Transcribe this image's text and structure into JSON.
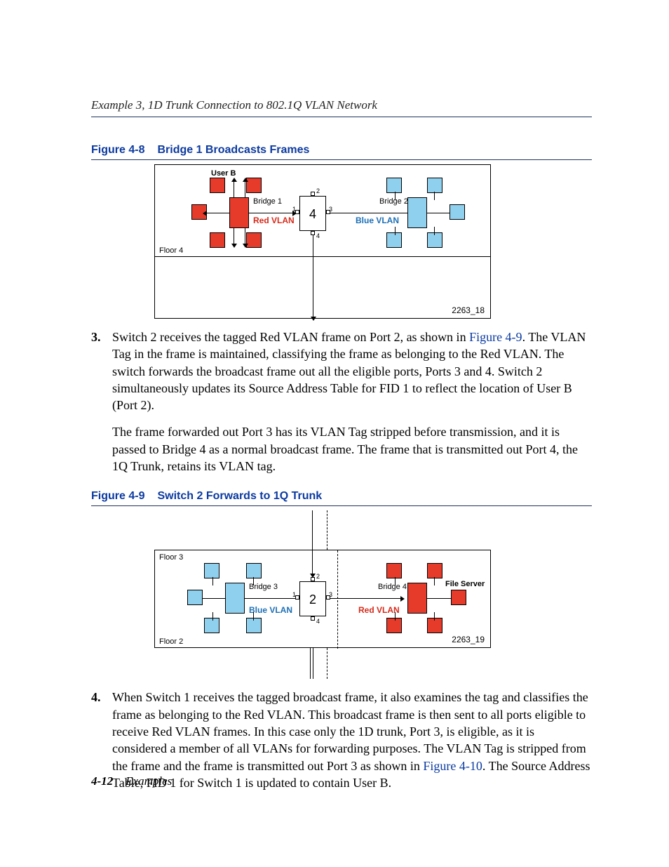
{
  "header": {
    "running": "Example 3, 1D Trunk Connection to 802.1Q VLAN Network"
  },
  "fig1": {
    "num": "Figure 4-8",
    "title": "Bridge 1 Broadcasts Frames",
    "userB": "User B",
    "bridge1": "Bridge 1",
    "bridge2": "Bridge 2",
    "redvlan": "Red VLAN",
    "bluevlan": "Blue VLAN",
    "floor": "Floor 4",
    "switch": "4",
    "p1": "1",
    "p2": "2",
    "p3": "3",
    "p4": "4",
    "id": "2263_18"
  },
  "step3": {
    "num": "3.",
    "a_pre": "Switch 2 receives the tagged Red VLAN frame on Port 2, as shown in ",
    "a_link": "Figure 4-9",
    "a_post": ". The VLAN Tag in the frame is maintained, classifying the frame as belonging to the Red VLAN. The switch forwards the broadcast frame out all the eligible ports, Ports 3 and 4. Switch 2 simultaneously updates its Source Address Table for FID 1 to reflect the location of User B (Port 2).",
    "b": "The frame forwarded out Port 3 has its VLAN Tag stripped before transmission, and it is passed to Bridge 4 as a normal broadcast frame. The frame that is transmitted out Port 4, the 1Q Trunk, retains its VLAN tag."
  },
  "fig2": {
    "num": "Figure 4-9",
    "title": "Switch 2 Forwards to 1Q Trunk",
    "floor3": "Floor 3",
    "floor2": "Floor 2",
    "bridge3": "Bridge 3",
    "bridge4": "Bridge 4",
    "fileserver": "File Server",
    "bluevlan": "Blue VLAN",
    "redvlan": "Red VLAN",
    "switch": "2",
    "p1": "1",
    "p2": "2",
    "p3": "3",
    "p4": "4",
    "id": "2263_19"
  },
  "step4": {
    "num": "4.",
    "a_pre": "When Switch 1 receives the tagged broadcast frame, it also examines the tag and classifies the frame as belonging to the Red VLAN. This broadcast frame is then sent to all ports eligible to receive Red VLAN frames. In this case only the 1D trunk, Port 3, is eligible, as it is considered a member of all VLANs for forwarding purposes. The VLAN Tag is stripped from the frame and the frame is transmitted out Port 3 as shown in ",
    "a_link": "Figure 4-10",
    "a_post": ". The Source Address Table, FID 1 for Switch 1 is updated to contain User B."
  },
  "footer": {
    "page": "4-12",
    "section": "Examples"
  }
}
